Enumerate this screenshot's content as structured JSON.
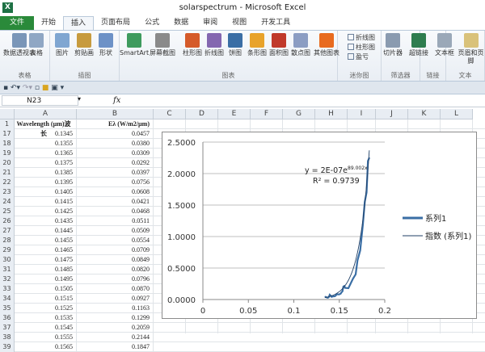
{
  "window": {
    "title": "solarspectrum - Microsoft Excel",
    "app_icon": "X"
  },
  "tabs": [
    {
      "label": "文件"
    },
    {
      "label": "开始"
    },
    {
      "label": "插入",
      "active": true
    },
    {
      "label": "页面布局"
    },
    {
      "label": "公式"
    },
    {
      "label": "数据"
    },
    {
      "label": "审阅"
    },
    {
      "label": "视图"
    },
    {
      "label": "开发工具"
    }
  ],
  "ribbon": {
    "groups": [
      {
        "label": "表格"
      },
      {
        "label": "插图"
      },
      {
        "label": "图表"
      },
      {
        "label": "迷你图"
      },
      {
        "label": "筛选器"
      },
      {
        "label": "链接"
      },
      {
        "label": "文本"
      }
    ],
    "buttons": [
      "数据透视表",
      "表格",
      "图片",
      "剪贴画",
      "形状",
      "SmartArt",
      "屏幕截图",
      "柱形图",
      "折线图",
      "饼图",
      "条形图",
      "面积图",
      "散点图",
      "其他图表",
      "切片器",
      "超链接",
      "文本框",
      "页眉和页脚"
    ],
    "sparklines": [
      "折线图",
      "柱形图",
      "盈亏"
    ]
  },
  "formula_bar": {
    "name_box": "N23",
    "fx": "fx",
    "formula": ""
  },
  "columns": [
    "A",
    "B",
    "C",
    "D",
    "E",
    "F",
    "G",
    "H",
    "I",
    "J",
    "K",
    "L"
  ],
  "header_row": {
    "row": "1",
    "a": "Wavelength (µm)波长",
    "b": "Eλ (W/m2/µm)"
  },
  "rows": [
    [
      "17",
      "0.1345",
      "0.0457"
    ],
    [
      "18",
      "0.1355",
      "0.0380"
    ],
    [
      "19",
      "0.1365",
      "0.0309"
    ],
    [
      "20",
      "0.1375",
      "0.0292"
    ],
    [
      "21",
      "0.1385",
      "0.0397"
    ],
    [
      "22",
      "0.1395",
      "0.0756"
    ],
    [
      "23",
      "0.1405",
      "0.0608"
    ],
    [
      "24",
      "0.1415",
      "0.0421"
    ],
    [
      "25",
      "0.1425",
      "0.0468"
    ],
    [
      "26",
      "0.1435",
      "0.0511"
    ],
    [
      "27",
      "0.1445",
      "0.0509"
    ],
    [
      "28",
      "0.1455",
      "0.0554"
    ],
    [
      "29",
      "0.1465",
      "0.0709"
    ],
    [
      "30",
      "0.1475",
      "0.0849"
    ],
    [
      "31",
      "0.1485",
      "0.0820"
    ],
    [
      "32",
      "0.1495",
      "0.0796"
    ],
    [
      "33",
      "0.1505",
      "0.0870"
    ],
    [
      "34",
      "0.1515",
      "0.0927"
    ],
    [
      "35",
      "0.1525",
      "0.1163"
    ],
    [
      "36",
      "0.1535",
      "0.1299"
    ],
    [
      "37",
      "0.1545",
      "0.2059"
    ],
    [
      "38",
      "0.1555",
      "0.2144"
    ],
    [
      "39",
      "0.1565",
      "0.1847"
    ]
  ],
  "chart_data": {
    "type": "scatter",
    "xlim": [
      0,
      0.2
    ],
    "ylim": [
      0,
      2.5
    ],
    "x_ticks": [
      "0",
      "0.05",
      "0.1",
      "0.15",
      "0.2"
    ],
    "y_ticks": [
      "0.0000",
      "0.5000",
      "1.0000",
      "1.5000",
      "2.0000",
      "2.5000"
    ],
    "grid": "horizontal",
    "legend_position": "right",
    "series": [
      {
        "name": "系列1",
        "color": "#3a6ea5",
        "points": [
          [
            0.1345,
            0.0457
          ],
          [
            0.1355,
            0.038
          ],
          [
            0.1365,
            0.0309
          ],
          [
            0.1375,
            0.0292
          ],
          [
            0.1385,
            0.0397
          ],
          [
            0.1395,
            0.0756
          ],
          [
            0.1405,
            0.0608
          ],
          [
            0.1415,
            0.0421
          ],
          [
            0.1425,
            0.0468
          ],
          [
            0.1435,
            0.0511
          ],
          [
            0.1445,
            0.0509
          ],
          [
            0.1455,
            0.0554
          ],
          [
            0.1465,
            0.0709
          ],
          [
            0.1475,
            0.0849
          ],
          [
            0.1485,
            0.082
          ],
          [
            0.1495,
            0.0796
          ],
          [
            0.1505,
            0.087
          ],
          [
            0.1515,
            0.0927
          ],
          [
            0.1525,
            0.1163
          ],
          [
            0.1535,
            0.1299
          ],
          [
            0.1545,
            0.2059
          ],
          [
            0.1555,
            0.2144
          ],
          [
            0.1565,
            0.1847
          ],
          [
            0.16,
            0.18
          ],
          [
            0.165,
            0.33
          ],
          [
            0.168,
            0.4
          ],
          [
            0.17,
            0.62
          ],
          [
            0.173,
            0.78
          ],
          [
            0.176,
            1.2
          ],
          [
            0.178,
            1.55
          ],
          [
            0.18,
            1.7
          ],
          [
            0.1815,
            2.2
          ],
          [
            0.183,
            2.25
          ]
        ]
      }
    ],
    "trendline": {
      "name": "指数 (系列1)",
      "type": "exponential",
      "a": 2e-07,
      "b": 89.002,
      "color": "#1f3f66",
      "equation": "y = 2E-07e",
      "exponent": "89.002x",
      "r2_label": "R² = 0.9739"
    }
  }
}
